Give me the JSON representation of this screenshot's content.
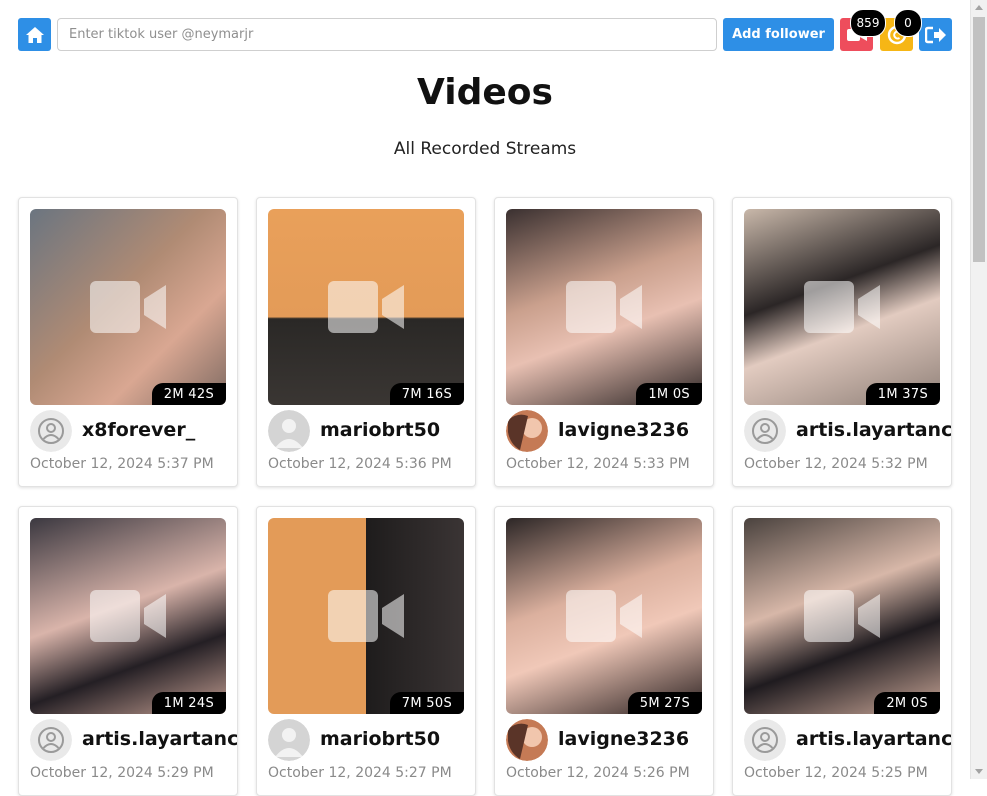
{
  "header": {
    "search_placeholder": "Enter tiktok user @neymarjr",
    "add_follower_label": "Add follower",
    "recordings_count": "859",
    "coins_count": "0"
  },
  "icons": {
    "home": "home-icon",
    "recordings": "video-camera-icon",
    "coins": "coin-icon",
    "logout": "logout-icon"
  },
  "colors": {
    "primary": "#2e8fe6",
    "danger": "#ee4d5c",
    "warning": "#f6b615"
  },
  "page": {
    "title": "Videos",
    "subtitle": "All Recorded Streams"
  },
  "videos": [
    {
      "username": "x8forever_",
      "duration": "2M 42S",
      "date": "October 12, 2024 5:37 PM"
    },
    {
      "username": "mariobrt50",
      "duration": "7M 16S",
      "date": "October 12, 2024 5:36 PM"
    },
    {
      "username": "lavigne3236",
      "duration": "1M 0S",
      "date": "October 12, 2024 5:33 PM"
    },
    {
      "username": "artis.layartancap",
      "duration": "1M 37S",
      "date": "October 12, 2024 5:32 PM"
    },
    {
      "username": "artis.layartancap",
      "duration": "1M 24S",
      "date": "October 12, 2024 5:29 PM"
    },
    {
      "username": "mariobrt50",
      "duration": "7M 50S",
      "date": "October 12, 2024 5:27 PM"
    },
    {
      "username": "lavigne3236",
      "duration": "5M 27S",
      "date": "October 12, 2024 5:26 PM"
    },
    {
      "username": "artis.layartancap",
      "duration": "2M 0S",
      "date": "October 12, 2024 5:25 PM"
    }
  ]
}
